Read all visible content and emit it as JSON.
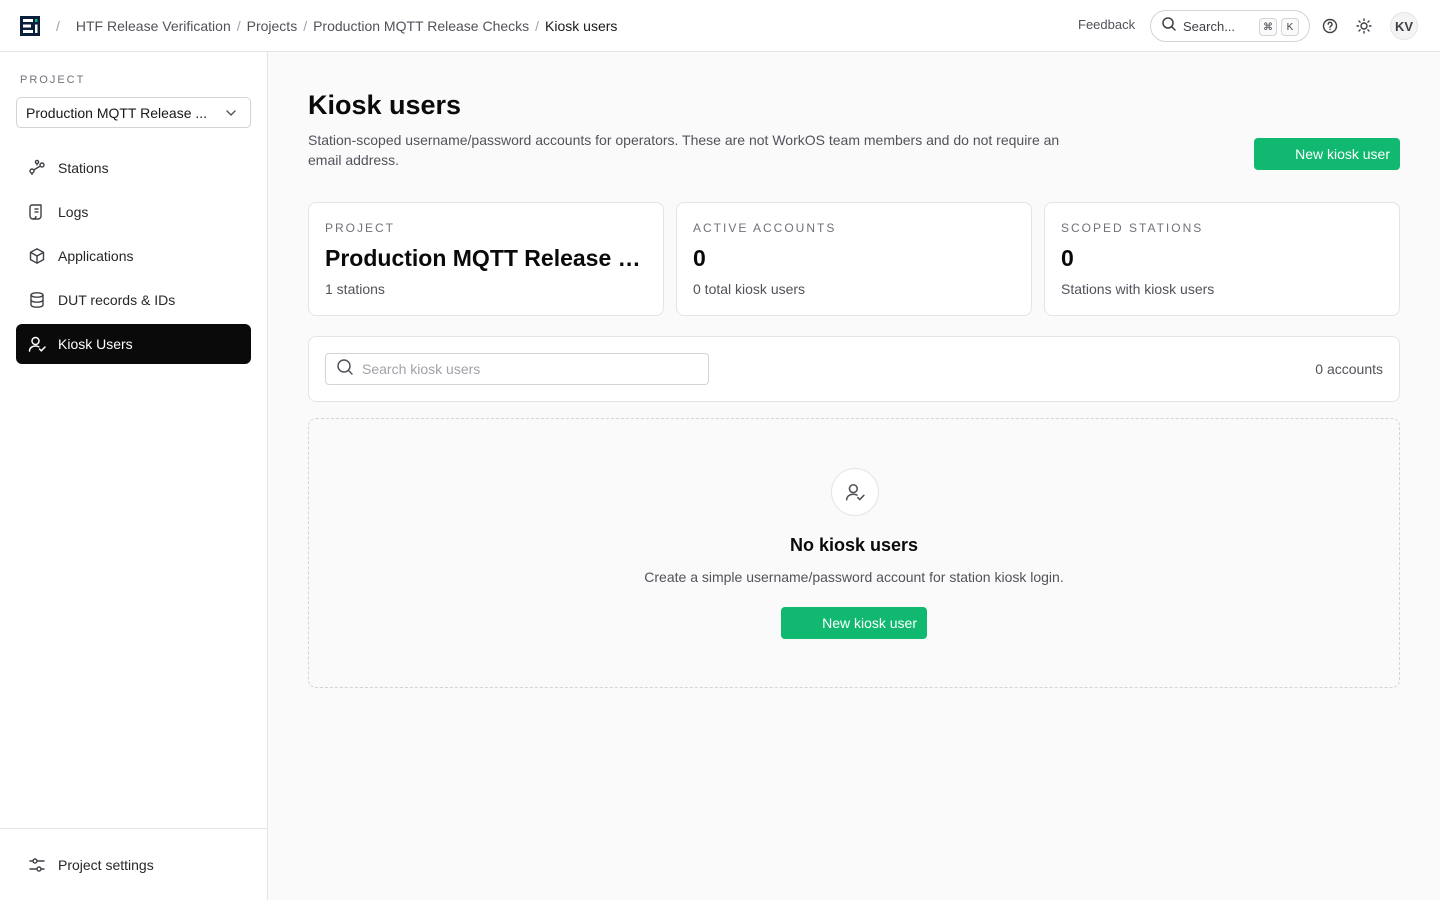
{
  "topbar": {
    "breadcrumbs": [
      "HTF Release Verification",
      "Projects",
      "Production MQTT Release Checks",
      "Kiosk users"
    ],
    "feedback_label": "Feedback",
    "search_label": "Search...",
    "shortcut_keys": [
      "⌘",
      "K"
    ],
    "avatar_initials": "KV"
  },
  "sidebar": {
    "section_label": "PROJECT",
    "project_select_value": "Production MQTT Release ...",
    "items": [
      {
        "label": "Stations",
        "icon": "stations-icon",
        "active": false
      },
      {
        "label": "Logs",
        "icon": "logs-icon",
        "active": false
      },
      {
        "label": "Applications",
        "icon": "box-icon",
        "active": false
      },
      {
        "label": "DUT records & IDs",
        "icon": "database-icon",
        "active": false
      },
      {
        "label": "Kiosk Users",
        "icon": "user-check-icon",
        "active": true
      }
    ],
    "settings_label": "Project settings"
  },
  "main": {
    "title": "Kiosk users",
    "description": "Station-scoped username/password accounts for operators. These are not WorkOS team members and do not require an email address.",
    "new_button_label": "New kiosk user",
    "stats": [
      {
        "key": "PROJECT",
        "value": "Production MQTT Release Checks",
        "sub": "1 stations"
      },
      {
        "key": "ACTIVE ACCOUNTS",
        "value": "0",
        "sub": "0 total kiosk users"
      },
      {
        "key": "SCOPED STATIONS",
        "value": "0",
        "sub": "Stations with kiosk users"
      }
    ],
    "search_placeholder": "Search kiosk users",
    "count_label": "0 accounts",
    "empty": {
      "title": "No kiosk users",
      "description": "Create a simple username/password account for station kiosk login.",
      "button_label": "New kiosk user"
    }
  },
  "colors": {
    "accent_green": "#10b96f",
    "active_nav": "#0a0a0a"
  }
}
